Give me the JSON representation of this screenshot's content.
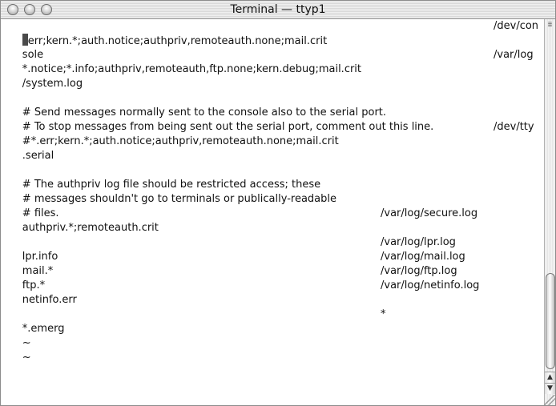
{
  "window": {
    "title": "Terminal — ttyp1"
  },
  "icons": {
    "close": "close-icon",
    "minimize": "minimize-icon",
    "zoom": "zoom-icon",
    "resize_top": "resize-lines-icon",
    "scroll_up": "arrow-up-icon",
    "scroll_down": "arrow-down-icon",
    "grip": "resize-grip-icon"
  },
  "glyphs": {
    "resize_top": "≣",
    "scroll_up": "▲",
    "scroll_down": "▼"
  },
  "terminal": {
    "cursor_char": "*",
    "line_1_rest": "err;kern.*;auth.notice;authpriv,remoteauth.none;mail.crit",
    "line_1_dest": "/dev/con",
    "line_2": "sole",
    "line_3": "*.notice;*.info;authpriv,remoteauth,ftp.none;kern.debug;mail.crit",
    "line_3_dest": "/var/log",
    "line_4": "/system.log",
    "line_6": "# Send messages normally sent to the console also to the serial port.",
    "line_7": "# To stop messages from being sent out the serial port, comment out this line.",
    "line_8": "#*.err;kern.*;auth.notice;authpriv,remoteauth.none;mail.crit",
    "line_8_dest": "/dev/tty",
    "line_9": ".serial",
    "line_11": "# The authpriv log file should be restricted access; these",
    "line_12": "# messages shouldn't go to terminals or publically-readable",
    "line_13": "# files.",
    "line_14": "authpriv.*;remoteauth.crit",
    "line_14_dest": "/var/log/secure.log",
    "line_16": "lpr.info",
    "line_16_dest": "/var/log/lpr.log",
    "line_17": "mail.*",
    "line_17_dest": "/var/log/mail.log",
    "line_18": "ftp.*",
    "line_18_dest": "/var/log/ftp.log",
    "line_19": "netinfo.err",
    "line_19_dest": "/var/log/netinfo.log",
    "line_21": "*.emerg",
    "line_21_dest": "*",
    "line_22": "~",
    "line_23": "~"
  }
}
